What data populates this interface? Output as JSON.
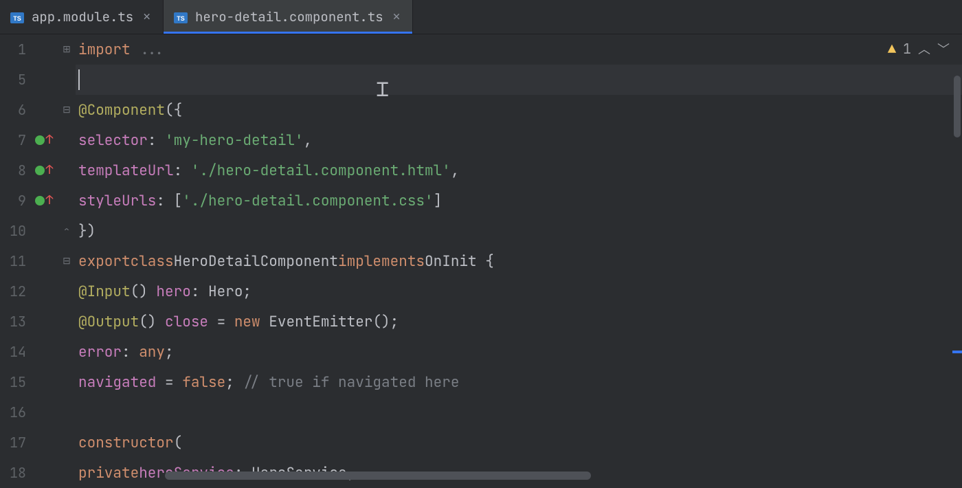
{
  "tabs": [
    {
      "label": "app.module.ts",
      "active": false
    },
    {
      "label": "hero-detail.component.ts",
      "active": true
    }
  ],
  "inspection": {
    "count": "1"
  },
  "gutter": [
    {
      "num": "1",
      "fold": "plus",
      "vcs": false
    },
    {
      "num": "5",
      "fold": "",
      "vcs": false
    },
    {
      "num": "6",
      "fold": "minus",
      "vcs": false
    },
    {
      "num": "7",
      "fold": "",
      "vcs": true
    },
    {
      "num": "8",
      "fold": "",
      "vcs": true
    },
    {
      "num": "9",
      "fold": "",
      "vcs": true
    },
    {
      "num": "10",
      "fold": "end",
      "vcs": false
    },
    {
      "num": "11",
      "fold": "minus",
      "vcs": false
    },
    {
      "num": "12",
      "fold": "",
      "vcs": false
    },
    {
      "num": "13",
      "fold": "",
      "vcs": false
    },
    {
      "num": "14",
      "fold": "",
      "vcs": false
    },
    {
      "num": "15",
      "fold": "",
      "vcs": false
    },
    {
      "num": "16",
      "fold": "",
      "vcs": false
    },
    {
      "num": "17",
      "fold": "",
      "vcs": false
    },
    {
      "num": "18",
      "fold": "",
      "vcs": false
    }
  ],
  "code": {
    "l1_kw": "import",
    "l1_hint": " ...",
    "l6_dec": "@Component",
    "l6_rest": "({",
    "l7_prop": "selector",
    "l7_colon": ": ",
    "l7_str": "'my-hero-detail'",
    "l7_comma": ",",
    "l8_prop": "templateUrl",
    "l8_colon": ": ",
    "l8_str": "'./hero-detail.component.html'",
    "l8_comma": ",",
    "l9_prop": "styleUrls",
    "l9_colon": ": [",
    "l9_str": "'./hero-detail.component.css'",
    "l9_close": "]",
    "l10": "})",
    "l11_export": "export",
    "l11_class": "class",
    "l11_name": "HeroDetailComponent",
    "l11_impl": "implements",
    "l11_oninit": "OnInit {",
    "l12_dec": "@Input",
    "l12_paren": "() ",
    "l12_prop": "hero",
    "l12_tail": ": Hero;",
    "l13_dec": "@Output",
    "l13_paren": "() ",
    "l13_prop": "close",
    "l13_eq": " = ",
    "l13_new": "new",
    "l13_tail": " EventEmitter();",
    "l14_prop": "error",
    "l14_colon": ": ",
    "l14_any": "any",
    "l14_semi": ";",
    "l15_prop": "navigated",
    "l15_eq": " = ",
    "l15_false": "false",
    "l15_semi": "; ",
    "l15_comment": "// true if navigated here",
    "l17_kw": "constructor",
    "l17_paren": "(",
    "l18_private": "private",
    "l18_prop": "heroService",
    "l18_tail": ": HeroService,"
  }
}
